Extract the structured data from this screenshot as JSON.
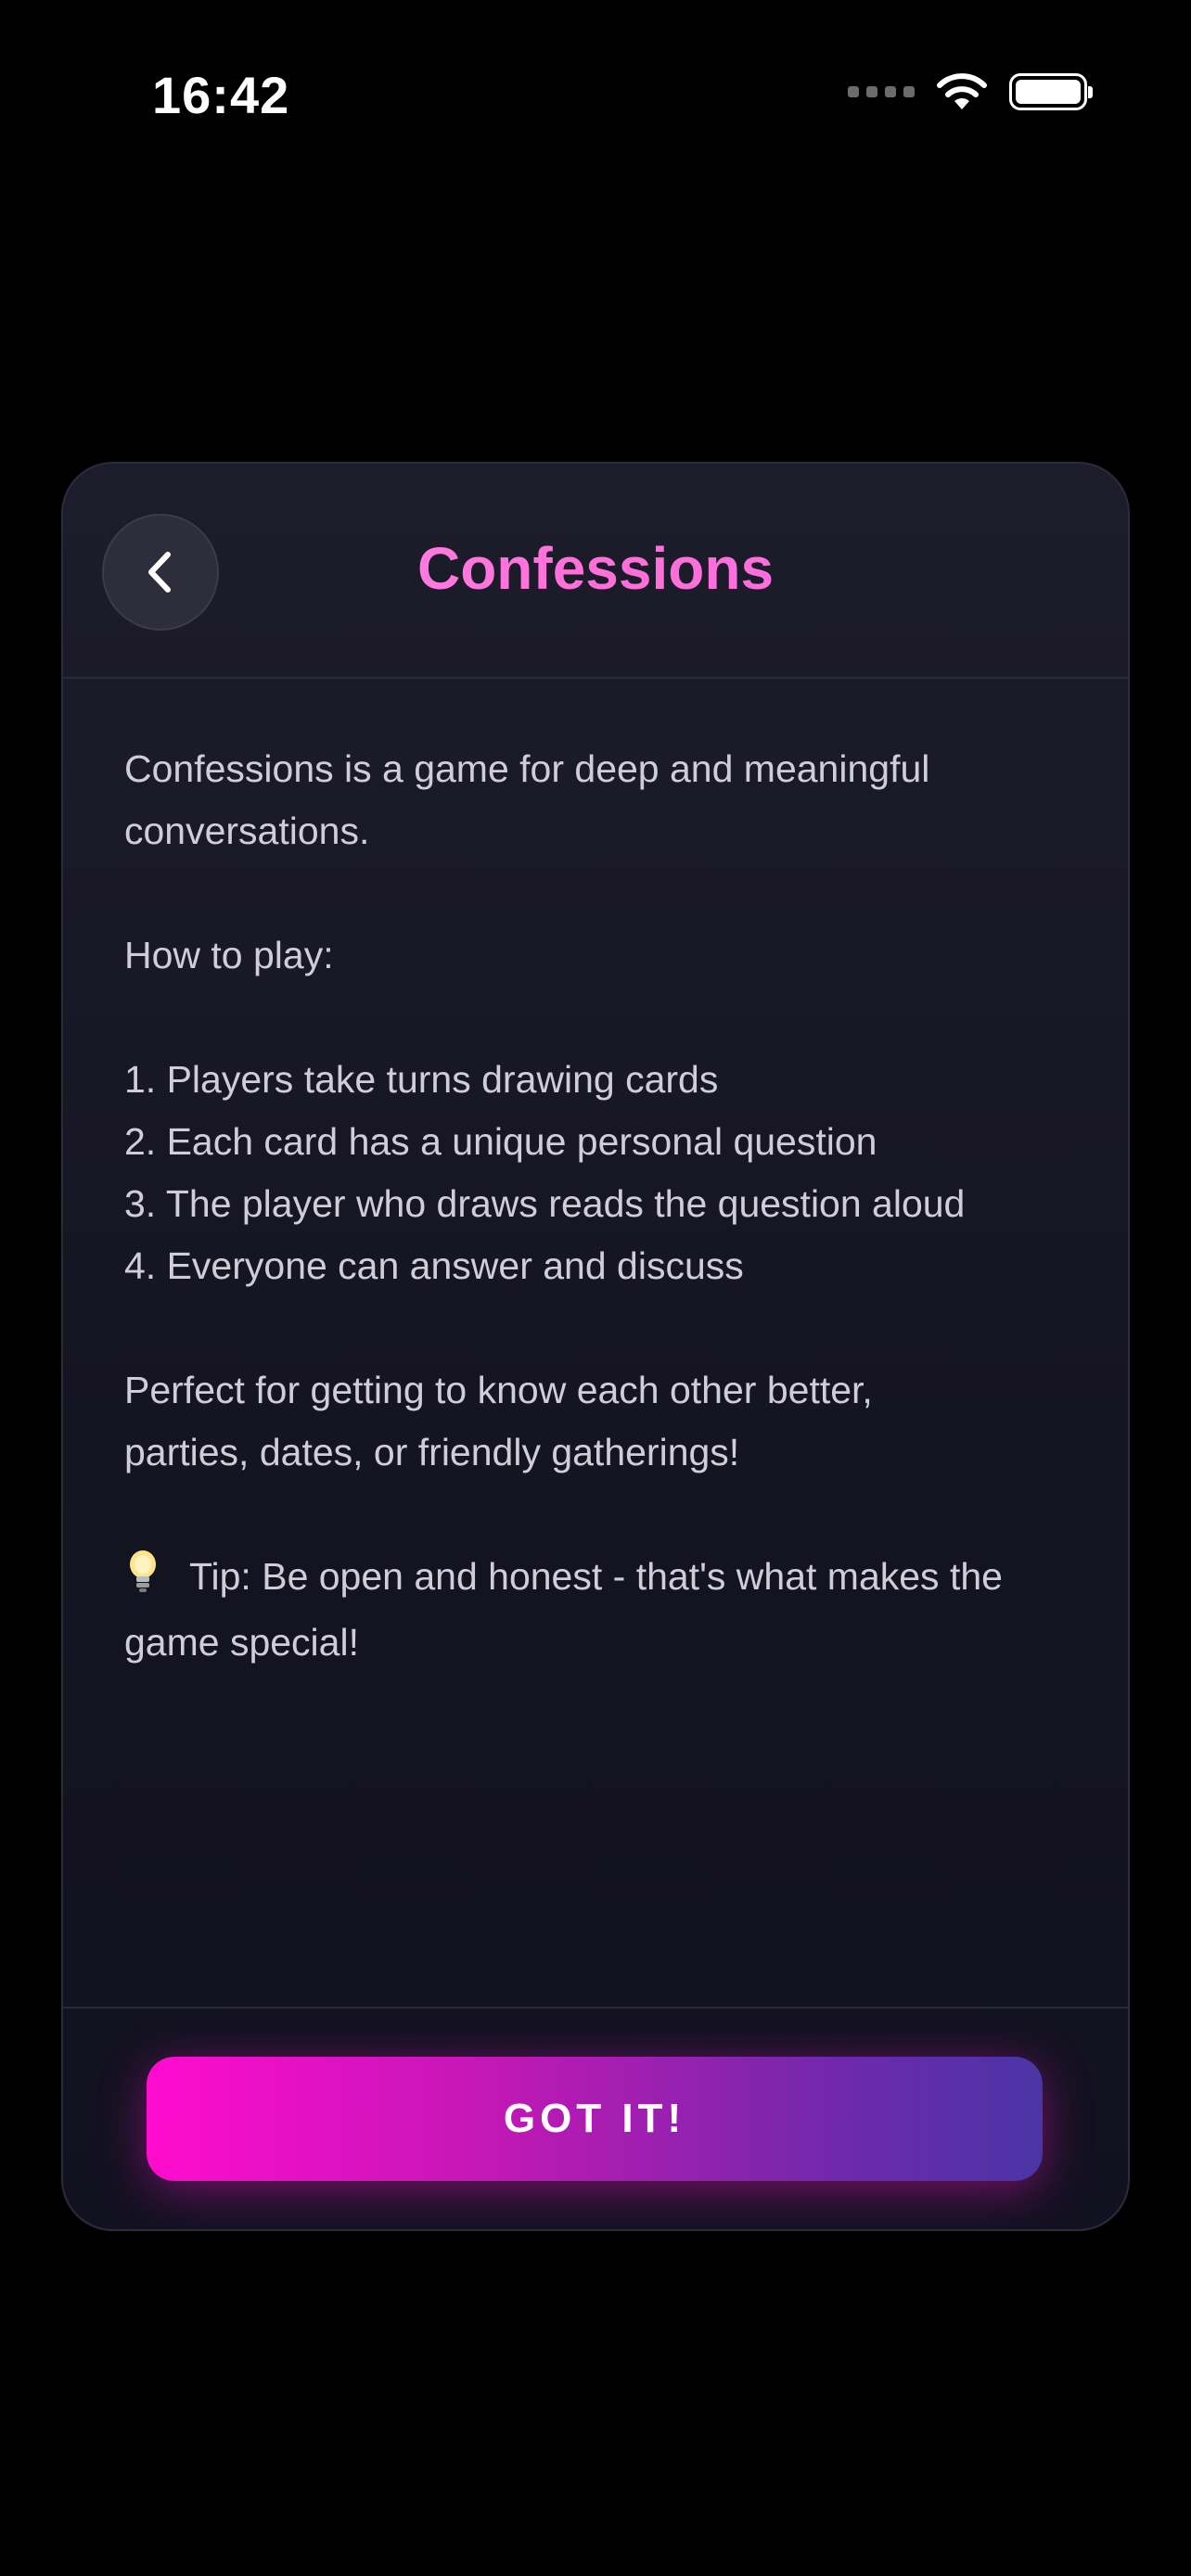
{
  "status_bar": {
    "time": "16:42"
  },
  "modal": {
    "title": "Confessions",
    "back_icon": "chevron-left-icon",
    "body": {
      "intro_line1": "Confessions is a game for deep and meaningful",
      "intro_line2": "conversations.",
      "how_to_play": "How to play:",
      "steps": [
        "1. Players take turns drawing cards",
        "2. Each card has a unique personal question",
        "3. The player who draws reads the question aloud",
        "4. Everyone can answer and discuss"
      ],
      "perfect_line1": "Perfect for getting to know each other better,",
      "perfect_line2": "parties, dates, or friendly gatherings!",
      "tip_icon": "lightbulb-icon",
      "tip_line1": "Tip: Be open and honest - that's what makes the",
      "tip_line2": "game special!"
    },
    "button_label": "GOT IT!"
  },
  "colors": {
    "background": "#000000",
    "card": "#1a1927",
    "title_accent": "#ff7ee6",
    "button_start": "#ff0ccf",
    "button_end": "#4a35a5"
  }
}
